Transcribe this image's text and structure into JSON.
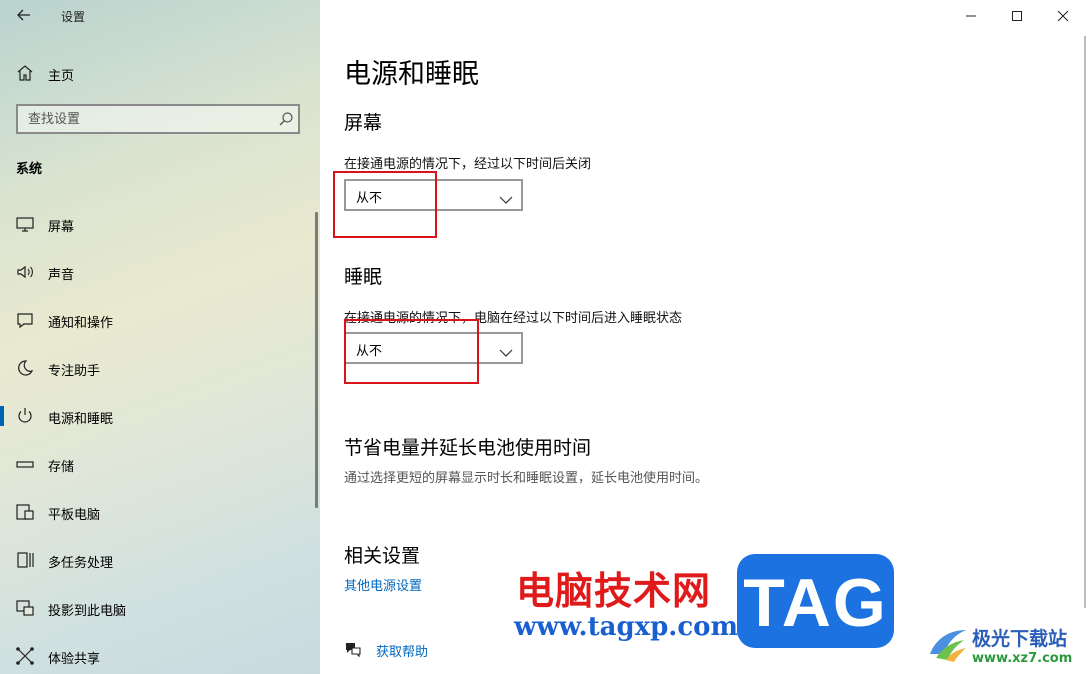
{
  "window": {
    "title": "设置"
  },
  "sidebar": {
    "home_label": "主页",
    "search_placeholder": "查找设置",
    "section_title": "系统",
    "items": [
      {
        "label": "屏幕",
        "icon": "monitor-icon"
      },
      {
        "label": "声音",
        "icon": "speaker-icon"
      },
      {
        "label": "通知和操作",
        "icon": "notification-icon"
      },
      {
        "label": "专注助手",
        "icon": "moon-icon"
      },
      {
        "label": "电源和睡眠",
        "icon": "power-icon",
        "selected": true
      },
      {
        "label": "存储",
        "icon": "storage-icon"
      },
      {
        "label": "平板电脑",
        "icon": "tablet-icon"
      },
      {
        "label": "多任务处理",
        "icon": "multitask-icon"
      },
      {
        "label": "投影到此电脑",
        "icon": "projection-icon"
      },
      {
        "label": "体验共享",
        "icon": "share-icon"
      }
    ]
  },
  "main": {
    "title": "电源和睡眠",
    "screen": {
      "heading": "屏幕",
      "description": "在接通电源的情况下，经过以下时间后关闭",
      "value": "从不"
    },
    "sleep": {
      "heading": "睡眠",
      "description": "在接通电源的情况下，电脑在经过以下时间后进入睡眠状态",
      "value": "从不"
    },
    "battery": {
      "heading": "节省电量并延长电池使用时间",
      "description": "通过选择更短的屏幕显示时长和睡眠设置，延长电池使用时间。"
    },
    "related": {
      "heading": "相关设置",
      "link": "其他电源设置"
    },
    "help_label": "获取帮助"
  },
  "watermark": {
    "site_name": "电脑技术网",
    "site_url": "www.tagxp.com",
    "tag": "TAG",
    "xz_name": "极光下载站",
    "xz_url": "www.xz7.com"
  },
  "colors": {
    "accent": "#0063b1",
    "link": "#0067c0",
    "highlight": "#d9121b"
  }
}
